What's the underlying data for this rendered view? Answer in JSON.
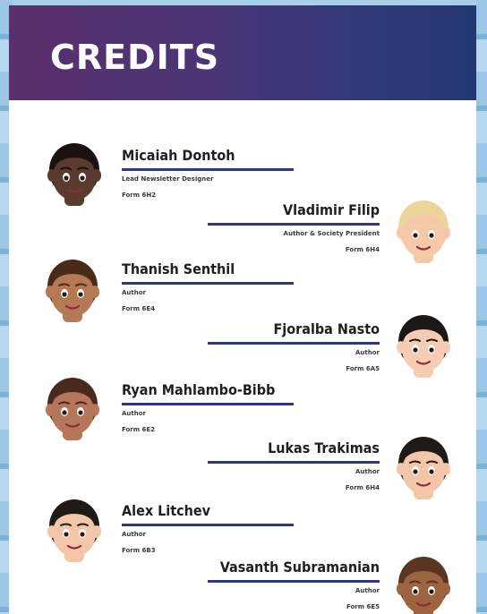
{
  "title": "CREDITS",
  "credits": [
    {
      "name": "Micaiah Dontoh",
      "role": "Lead Newsletter Designer",
      "form": "Form 6H2"
    },
    {
      "name": "Vladimir Filip",
      "role": "Author & Society President",
      "form": "Form 6H4"
    },
    {
      "name": "Thanish Senthil",
      "role": "Author",
      "form": "Form 6E4"
    },
    {
      "name": "Fjoralba Nasto",
      "role": "Author",
      "form": "Form 6A5"
    },
    {
      "name": "Ryan Mahlambo-Bibb",
      "role": "Author",
      "form": "Form 6E2"
    },
    {
      "name": "Lukas Trakimas",
      "role": "Author",
      "form": "Form 6H4"
    },
    {
      "name": "Alex Litchev",
      "role": "Author",
      "form": "Form 6B3"
    },
    {
      "name": "Vasanth Subramanian",
      "role": "Author",
      "form": "Form 6E5"
    }
  ],
  "avatars": [
    {
      "icon": "person-avatar-dark-skin-icon",
      "skin": "#5a3b2e",
      "hair": "#1b1210"
    },
    {
      "icon": "person-avatar-blond-icon",
      "skin": "#f5c9a8",
      "hair": "#ecd49a"
    },
    {
      "icon": "person-avatar-bearded-icon",
      "skin": "#b57a55",
      "hair": "#4a2b1a"
    },
    {
      "icon": "person-avatar-woman-icon",
      "skin": "#f6cdb4",
      "hair": "#1c1715"
    },
    {
      "icon": "person-avatar-curly-hair-icon",
      "skin": "#b5765a",
      "hair": "#4a2a1e"
    },
    {
      "icon": "person-avatar-black-hair-icon",
      "skin": "#f4c6a9",
      "hair": "#201a17"
    },
    {
      "icon": "person-avatar-black-hair-icon",
      "skin": "#f4c6a9",
      "hair": "#201a17"
    },
    {
      "icon": "person-avatar-brown-skin-icon",
      "skin": "#9c6440",
      "hair": "#5a3622"
    }
  ]
}
